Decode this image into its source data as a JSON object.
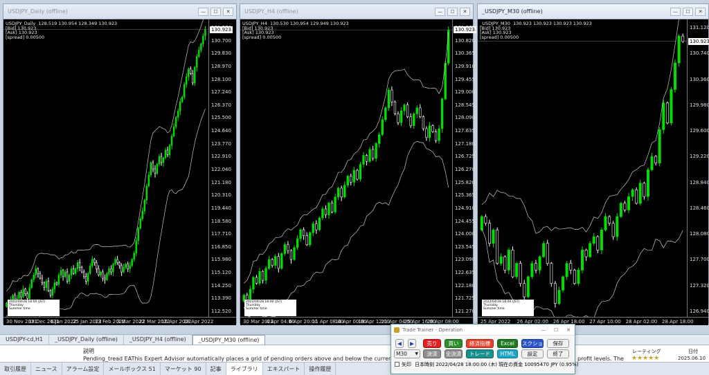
{
  "colors": {
    "bull": "#00e000",
    "bear": "#ffffff",
    "band": "#c8c8c8",
    "chart_bg": "#000000"
  },
  "windows": [
    {
      "title": "USDJPY_Daily (offline)",
      "info": [
        "USDJPY_Daily  128.519 130.954 128.349 130.923",
        "[Bid] 130.923",
        "[Ask] 130.923",
        "[spread] 0.00500"
      ],
      "price_label": "130.923",
      "yticks": [
        "131.570",
        "130.700",
        "129.830",
        "128.970",
        "128.100",
        "127.240",
        "126.370",
        "125.500",
        "124.640",
        "123.770",
        "122.910",
        "122.040",
        "121.180",
        "120.310",
        "119.440",
        "118.580",
        "117.710",
        "116.850",
        "115.980",
        "115.120",
        "114.250",
        "113.390",
        "112.520"
      ],
      "xticks": [
        "30 Nov 2021",
        "19 Dec 2021",
        "6 Jan 2022",
        "25 Jan 2022",
        "13 Feb 2022",
        "3 Mar 2022",
        "22 Mar 2022",
        "10 Apr 2022",
        "28 Apr 2022"
      ],
      "datebox": [
        "2022/04/28 18:00 (JST)",
        "Thursday",
        "Summer time"
      ],
      "series": {
        "range": [
          112.52,
          131.57
        ],
        "closes": [
          113.4,
          113.1,
          113.6,
          113.9,
          113.5,
          113.7,
          114.1,
          113.8,
          114.3,
          114.0,
          113.7,
          114.4,
          114.9,
          115.2,
          115.6,
          115.3,
          115.0,
          114.7,
          114.4,
          114.8,
          114.2,
          113.9,
          114.3,
          114.7,
          114.6,
          115.2,
          115.5,
          115.1,
          115.4,
          114.8,
          115.2,
          115.6,
          115.3,
          115.6,
          116.0,
          115.7,
          115.4,
          115.1,
          114.8,
          115.3,
          115.8,
          116.2,
          116.0,
          115.6,
          115.2,
          115.4,
          115.0,
          114.9,
          115.3,
          115.6,
          115.4,
          115.9,
          116.2,
          116.0,
          115.8,
          115.4,
          115.7,
          115.9,
          115.6,
          115.8,
          116.2,
          116.6,
          117.4,
          118.2,
          118.8,
          119.3,
          120.0,
          120.9,
          121.6,
          122.4,
          122.0,
          121.7,
          122.3,
          122.8,
          122.4,
          122.7,
          123.2,
          122.9,
          123.5,
          124.1,
          124.7,
          125.3,
          125.7,
          126.3,
          126.6,
          127.4,
          127.9,
          128.4,
          128.1,
          127.5,
          128.5,
          129.2,
          129.6,
          130.0,
          130.5,
          130.92
        ],
        "start_i": 0,
        "total": 96
      }
    },
    {
      "title": "USDJPY_H4 (offline)",
      "info": [
        "USDJPY_H4  130.530 130.954 129.949 130.923",
        "[Bid] 130.923",
        "[Ask] 130.923",
        "[spread] 0.00500"
      ],
      "price_label": "130.923",
      "yticks": [
        "131.275",
        "130.820",
        "130.365",
        "129.910",
        "129.455",
        "129.000",
        "128.545",
        "128.090",
        "127.635",
        "127.180",
        "126.725",
        "126.270",
        "125.820",
        "125.365",
        "124.910",
        "124.455",
        "124.000",
        "123.545",
        "123.090",
        "122.635",
        "122.180",
        "121.725",
        "121.270"
      ],
      "xticks": [
        "30 Mar 2022",
        "4 Apr 04:00",
        "6 Apr 20:00",
        "11 Apr 08:00",
        "14 Apr 00:00",
        "18 Apr 12:00",
        "21 Apr 04:00",
        "25 Apr 16:00",
        "28 Apr 08:00"
      ],
      "datebox": [
        "2022/04/28 18:00 (JST)",
        "Thursday",
        "Summer time"
      ],
      "series": {
        "range": [
          121.27,
          131.275
        ],
        "closes": [
          122.0,
          121.8,
          122.2,
          122.6,
          122.4,
          122.8,
          122.5,
          122.9,
          123.2,
          123.0,
          123.3,
          122.9,
          123.4,
          123.7,
          123.5,
          123.2,
          123.6,
          123.9,
          124.2,
          124.0,
          123.7,
          124.1,
          124.4,
          124.2,
          124.6,
          124.9,
          124.7,
          125.1,
          124.8,
          125.3,
          125.6,
          125.3,
          125.7,
          126.0,
          125.8,
          126.2,
          125.9,
          126.4,
          126.7,
          126.5,
          126.9,
          126.6,
          127.1,
          127.4,
          127.9,
          128.3,
          128.9,
          128.5,
          128.1,
          127.8,
          128.2,
          128.4,
          128.0,
          127.7,
          128.1,
          128.3,
          128.0,
          127.6,
          127.3,
          127.7,
          127.5,
          127.2,
          127.6,
          128.6,
          129.8,
          130.92
        ],
        "start_i": 0,
        "total": 66
      }
    },
    {
      "title": "_USDJPY_M30 (offline)",
      "info": [
        "_USDJPY_M30  130.923 130.923 130.923 130.923",
        "[Bid] 130.923",
        "[Ask] 130.923",
        "[spread] 0.00500"
      ],
      "price_label": "130.923",
      "yticks": [
        "131.120",
        "130.740",
        "130.360",
        "129.980",
        "129.600",
        "129.220",
        "128.840",
        "128.460",
        "128.080",
        "127.700",
        "127.320",
        "126.940"
      ],
      "xticks": [
        "25 Apr 2022",
        "26 Apr 02:00",
        "26 Apr 18:00",
        "27 Apr 10:00",
        "28 Apr 02:00",
        "28 Apr 18:00"
      ],
      "datebox": [
        "2022/04/28 18:00 (JST)",
        "Thursday",
        "Summer time"
      ],
      "series": {
        "range": [
          126.8,
          131.25
        ],
        "closes": [
          128.3,
          128.2,
          127.9,
          128.1,
          127.6,
          127.7,
          127.5,
          127.8,
          127.4,
          127.6,
          127.3,
          127.1,
          127.4,
          127.6,
          127.5,
          127.7,
          127.9,
          127.6,
          127.3,
          127.0,
          127.2,
          127.4,
          127.6,
          127.5,
          127.3,
          127.5,
          127.8,
          127.7,
          127.9,
          128.0,
          127.8,
          128.1,
          128.3,
          128.2,
          128.0,
          128.3,
          128.5,
          128.4,
          128.6,
          128.7,
          128.5,
          128.8,
          128.6,
          129.0,
          129.2,
          129.1,
          129.6,
          130.0,
          129.7,
          130.2,
          130.6,
          131.0,
          130.92
        ],
        "start_i": 0,
        "total": 53
      }
    }
  ],
  "chart_tabs": [
    "USDJPY-cd,H1",
    "_USDJPY_Daily (offline)",
    "_USDJPY_H4 (offline)",
    "_USDJPY_M30 (offline)"
  ],
  "bottom": {
    "header_desc": "説明",
    "desc": "Pending_tread EAThis Expert Advisor automatically places a grid of pending orders above and below the current market price. It supports both",
    "desc_tail": "profit levels. The",
    "rating_label": "レーティング",
    "stars": "★★★★★",
    "date_label": "日付",
    "date_value": "2025.06.10"
  },
  "terminal_tabs": [
    "取引履歴",
    "ニュース",
    "アラーム設定",
    "メールボックス 51",
    "マーケット 90",
    "記事",
    "ライブラリ",
    "エキスパート",
    "操作履歴"
  ],
  "dialog": {
    "title": "Trade Trainer - Operation",
    "prev": "◀",
    "next": "▶",
    "sell": "売り",
    "buy": "買い",
    "settle_spec": "経済指標",
    "excel": "Excel",
    "scrshot": "スクショ",
    "save": "保存",
    "timeframe": "M30",
    "settle": "決済",
    "settle_all": "全決済",
    "trade": "トレード",
    "html": "HTML",
    "settings": "設定",
    "exit": "終了",
    "arrow_label": "矢印",
    "status": "日本時刻 2022/04/28 18:00:00 (木)   現在の資金 10095470 JPY (0.95%)"
  }
}
